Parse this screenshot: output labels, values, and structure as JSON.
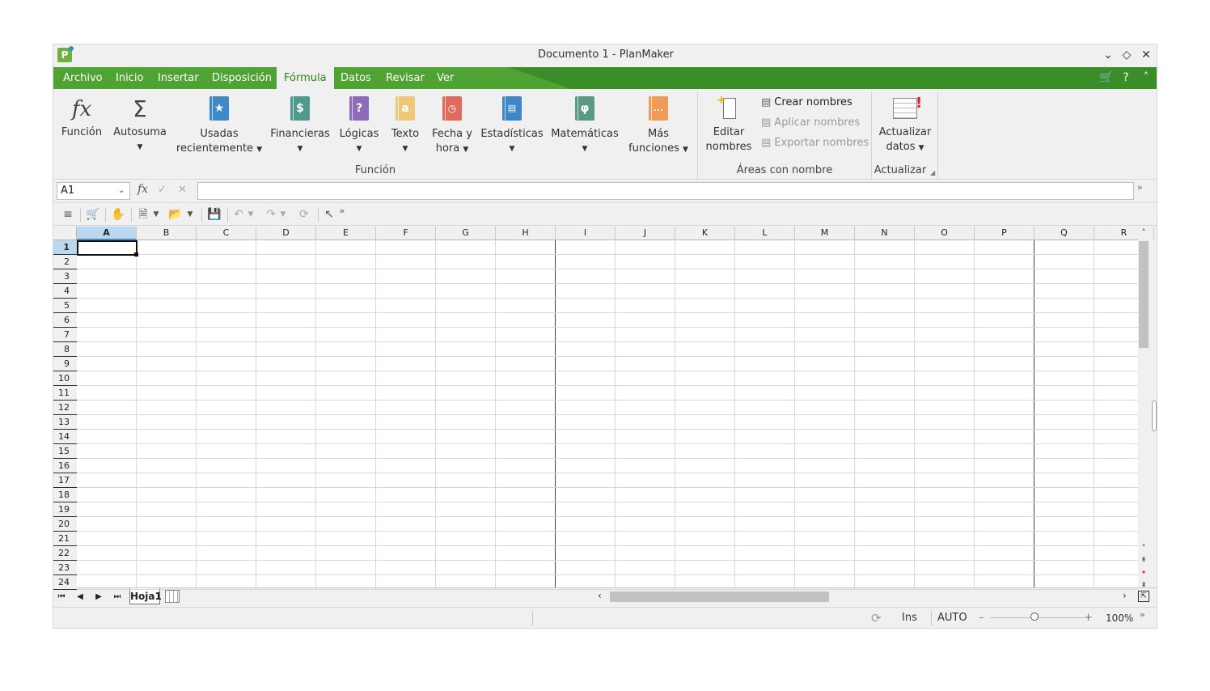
{
  "window": {
    "title": "Documento 1 - PlanMaker",
    "logo": "P"
  },
  "menu": {
    "items": [
      "Archivo",
      "Inicio",
      "Insertar",
      "Disposición",
      "Fórmula",
      "Datos",
      "Revisar",
      "Ver"
    ],
    "active": "Fórmula"
  },
  "ribbon": {
    "funcion": {
      "label": "Función"
    },
    "autosuma": {
      "label": "Autosuma"
    },
    "usadas": {
      "line1": "Usadas",
      "line2": "recientemente"
    },
    "financieras": {
      "label": "Financieras",
      "color": "#4f9a8e",
      "glyph": "$"
    },
    "logicas": {
      "label": "Lógicas",
      "color": "#8e6bb6",
      "glyph": "?"
    },
    "texto": {
      "label": "Texto",
      "color": "#efc77a",
      "glyph": "a"
    },
    "fecha": {
      "line1": "Fecha y",
      "line2": "hora",
      "color": "#e26a5a"
    },
    "estadisticas": {
      "label": "Estadísticas",
      "color": "#3e86c6"
    },
    "matematicas": {
      "label": "Matemáticas",
      "color": "#5a9a84",
      "glyph": "φ"
    },
    "mas": {
      "line1": "Más",
      "line2": "funciones",
      "color": "#ef9a56",
      "glyph": "..."
    },
    "editar": {
      "line1": "Editar",
      "line2": "nombres"
    },
    "crear_nombres": "Crear nombres",
    "aplicar_nombres": "Aplicar nombres",
    "exportar_nombres": "Exportar nombres",
    "actualizar": {
      "line1": "Actualizar",
      "line2": "datos"
    },
    "groups": {
      "funcion": "Función",
      "areas": "Áreas con nombre",
      "actualizar": "Actualizar"
    }
  },
  "formula_bar": {
    "name_box": "A1",
    "fx": "fx",
    "content": ""
  },
  "grid": {
    "columns": [
      "A",
      "B",
      "C",
      "D",
      "E",
      "F",
      "G",
      "H",
      "I",
      "J",
      "K",
      "L",
      "M",
      "N",
      "O",
      "P",
      "Q",
      "R"
    ],
    "rows": [
      "1",
      "2",
      "3",
      "4",
      "5",
      "6",
      "7",
      "8",
      "9",
      "10",
      "11",
      "12",
      "13",
      "14",
      "15",
      "16",
      "17",
      "18",
      "19",
      "20",
      "21",
      "22",
      "23",
      "24"
    ],
    "selected_cell": "A1"
  },
  "sheets": {
    "tabs": [
      "Hoja1"
    ],
    "active": "Hoja1"
  },
  "status": {
    "mode": "Ins",
    "calc": "AUTO",
    "zoom": "100%"
  }
}
